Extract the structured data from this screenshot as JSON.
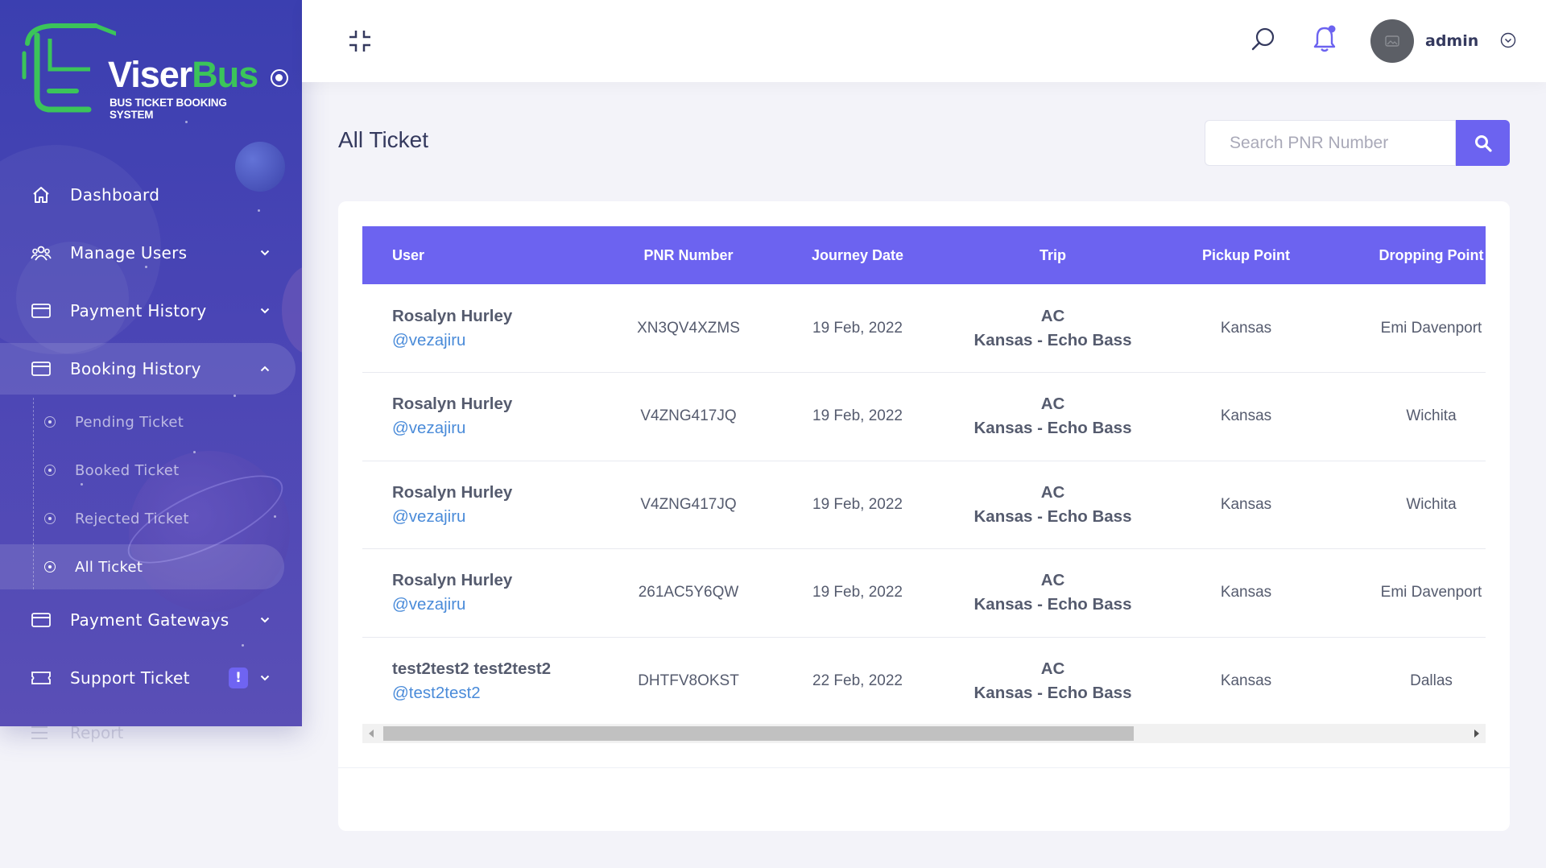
{
  "brand": {
    "name_part1": "Viser",
    "name_part2": "Bus",
    "tagline": "BUS TICKET BOOKING SYSTEM"
  },
  "sidebar": {
    "items": [
      {
        "label": "Dashboard",
        "icon": "home-icon"
      },
      {
        "label": "Manage Users",
        "icon": "users-icon"
      },
      {
        "label": "Payment History",
        "icon": "credit-card-icon"
      },
      {
        "label": "Booking History",
        "icon": "credit-card-icon"
      },
      {
        "label": "Payment Gateways",
        "icon": "credit-card-icon"
      },
      {
        "label": "Support Ticket",
        "icon": "ticket-icon",
        "badge": "!"
      },
      {
        "label": "Report",
        "icon": "list-icon"
      }
    ],
    "booking_sub": [
      {
        "label": "Pending Ticket"
      },
      {
        "label": "Booked Ticket"
      },
      {
        "label": "Rejected Ticket"
      },
      {
        "label": "All Ticket"
      }
    ]
  },
  "topbar": {
    "username": "admin"
  },
  "page": {
    "title": "All Ticket",
    "search_placeholder": "Search PNR Number"
  },
  "table": {
    "headers": [
      "User",
      "PNR Number",
      "Journey Date",
      "Trip",
      "Pickup Point",
      "Dropping Point"
    ],
    "rows": [
      {
        "name": "Rosalyn Hurley",
        "handle": "@vezajiru",
        "pnr": "XN3QV4XZMS",
        "date": "19 Feb, 2022",
        "trip_class": "AC",
        "trip_route": "Kansas - Echo Bass",
        "pickup": "Kansas",
        "dropping": "Emi Davenport"
      },
      {
        "name": "Rosalyn Hurley",
        "handle": "@vezajiru",
        "pnr": "V4ZNG417JQ",
        "date": "19 Feb, 2022",
        "trip_class": "AC",
        "trip_route": "Kansas - Echo Bass",
        "pickup": "Kansas",
        "dropping": "Wichita"
      },
      {
        "name": "Rosalyn Hurley",
        "handle": "@vezajiru",
        "pnr": "V4ZNG417JQ",
        "date": "19 Feb, 2022",
        "trip_class": "AC",
        "trip_route": "Kansas - Echo Bass",
        "pickup": "Kansas",
        "dropping": "Wichita"
      },
      {
        "name": "Rosalyn Hurley",
        "handle": "@vezajiru",
        "pnr": "261AC5Y6QW",
        "date": "19 Feb, 2022",
        "trip_class": "AC",
        "trip_route": "Kansas - Echo Bass",
        "pickup": "Kansas",
        "dropping": "Emi Davenport"
      },
      {
        "name": "test2test2 test2test2",
        "handle": "@test2test2",
        "pnr": "DHTFV8OKST",
        "date": "22 Feb, 2022",
        "trip_class": "AC",
        "trip_route": "Kansas - Echo Bass",
        "pickup": "Kansas",
        "dropping": "Dallas"
      }
    ]
  },
  "colors": {
    "accent": "#6c63f0",
    "sidebar_top": "#3b3fb0",
    "sidebar_bottom": "#5a4fb6",
    "logo_green": "#3bc45a",
    "link": "#4a8bd9"
  }
}
